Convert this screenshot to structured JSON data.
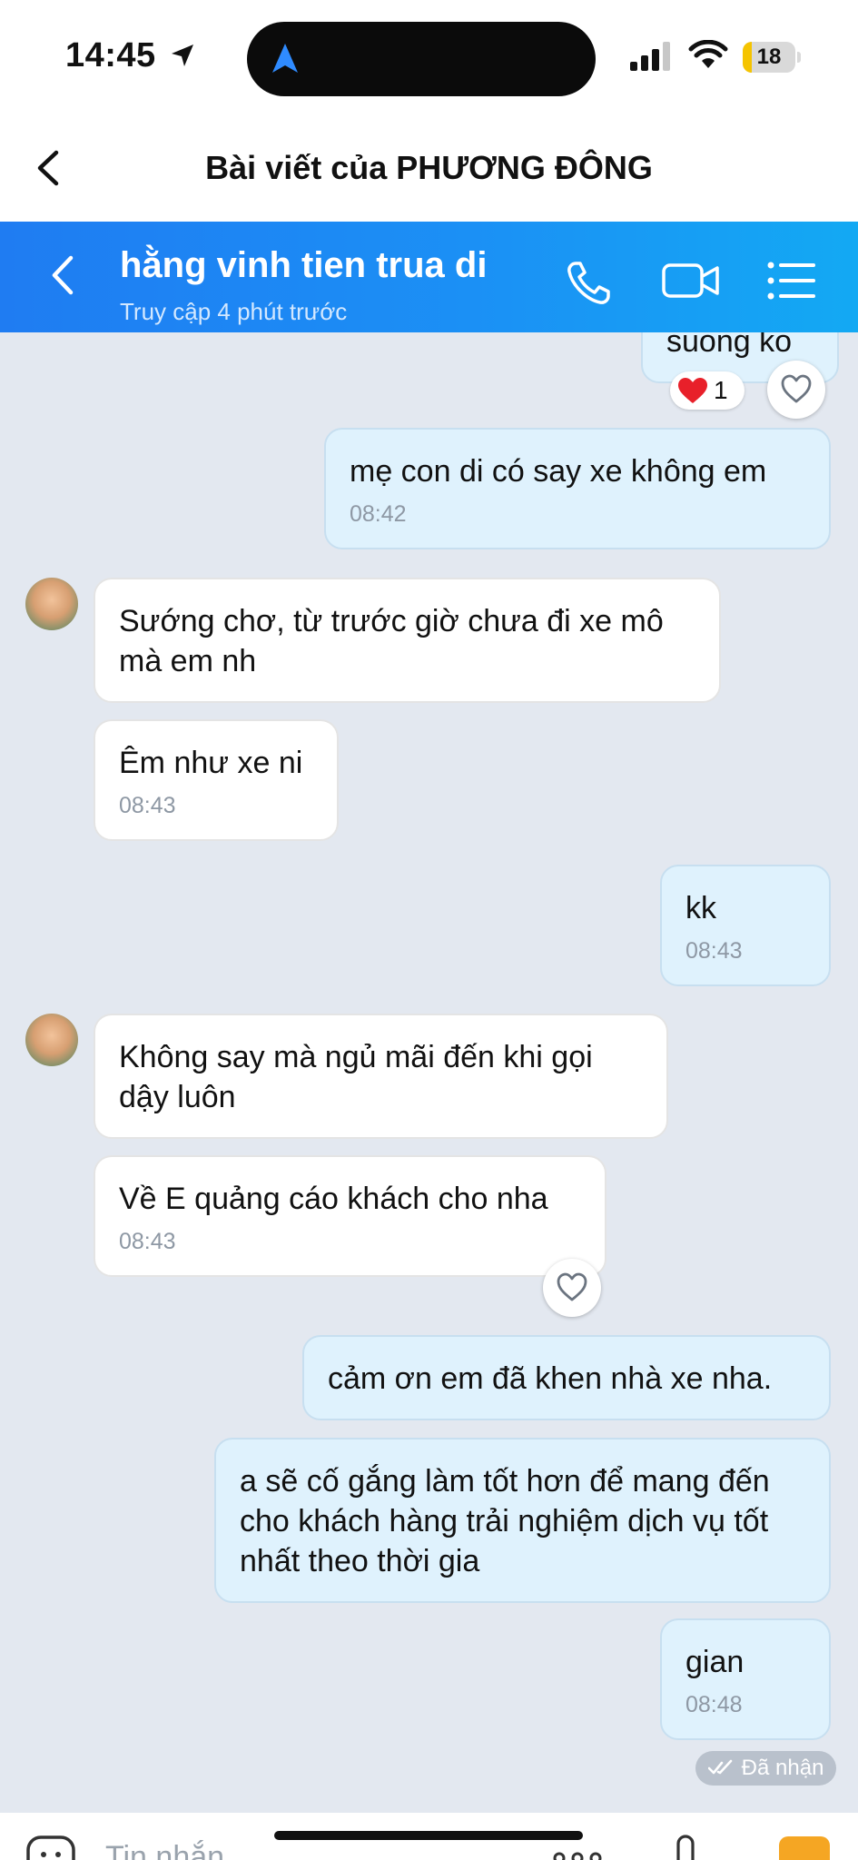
{
  "status_bar": {
    "time": "14:45",
    "battery": "18",
    "battery_level": 0.18
  },
  "post_header": {
    "title": "Bài viết của PHƯƠNG ĐÔNG"
  },
  "chat_header": {
    "name": "hằng vinh tien trua di",
    "status": "Truy cập 4 phút trước"
  },
  "messages": [
    {
      "dir": "out",
      "text": "suong ko",
      "reaction": {
        "emoji": "❤️",
        "count": "1"
      }
    },
    {
      "dir": "out",
      "text": "mẹ con di có say xe không em",
      "time": "08:42"
    },
    {
      "dir": "in",
      "text": "Sướng chơ, từ trước giờ chưa đi xe mô mà em nh"
    },
    {
      "dir": "in",
      "text": "Êm như xe ni",
      "time": "08:43"
    },
    {
      "dir": "out",
      "text": "kk",
      "time": "08:43"
    },
    {
      "dir": "in",
      "text": "Không say mà ngủ mãi đến khi gọi dậy luôn"
    },
    {
      "dir": "in",
      "text": "Về E quảng cáo khách cho nha",
      "time": "08:43"
    },
    {
      "dir": "out",
      "text": "cảm ơn em đã khen nhà xe nha."
    },
    {
      "dir": "out",
      "text": "a sẽ cố gắng làm tốt hơn để mang đến cho khách hàng trải nghiệm dịch vụ tốt nhất theo thời gia"
    },
    {
      "dir": "out",
      "text": "gian",
      "time": "08:48"
    }
  ],
  "delivery_status": "Đã nhận",
  "input": {
    "placeholder": "Tin nhắn"
  },
  "colors": {
    "header_blue": "#1b90f5",
    "out_bubble": "#dff2fd",
    "chat_bg": "#e3e8f0"
  }
}
